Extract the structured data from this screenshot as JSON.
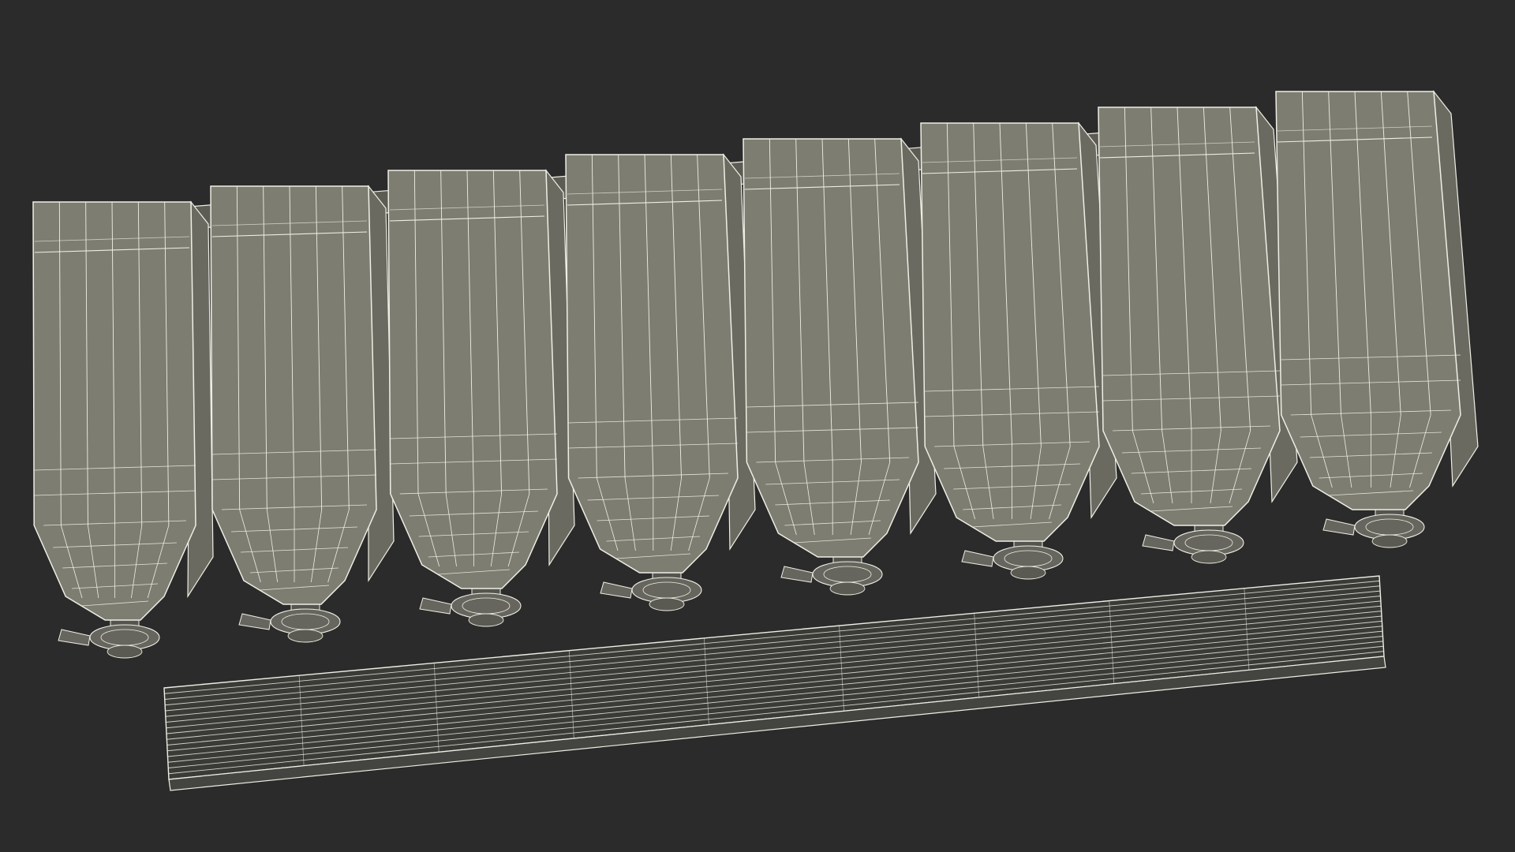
{
  "scene": {
    "subject": "wireframe-render",
    "background_color": "#2b2b2b",
    "surface_color": "#7d7d72",
    "surface_shade_color": "#6a6a60",
    "wire_color": "#efefe6",
    "rail_color": "#5c5c54"
  },
  "dispensers": {
    "count": 8
  }
}
